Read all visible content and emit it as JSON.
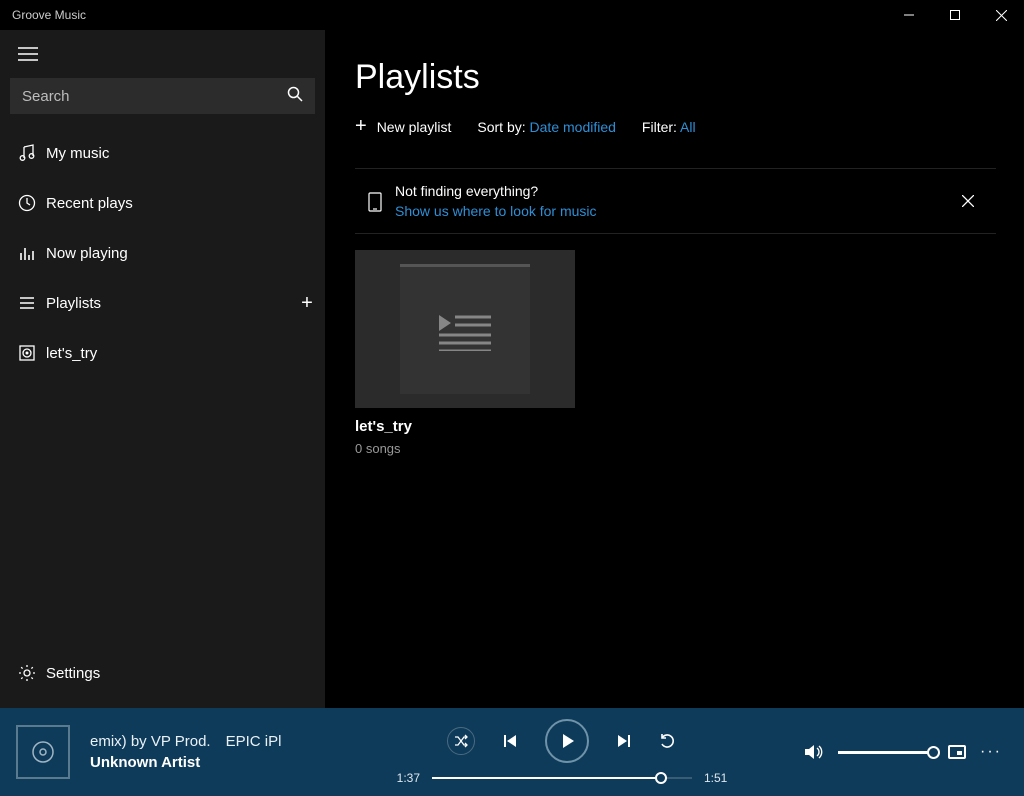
{
  "titlebar": {
    "title": "Groove Music"
  },
  "sidebar": {
    "search_placeholder": "Search",
    "items": [
      {
        "label": "My music"
      },
      {
        "label": "Recent plays"
      },
      {
        "label": "Now playing"
      },
      {
        "label": "Playlists"
      },
      {
        "label": "let's_try"
      }
    ],
    "settings_label": "Settings"
  },
  "main": {
    "heading": "Playlists",
    "new_playlist_label": "New playlist",
    "sort_label": "Sort by:",
    "sort_value": "Date modified",
    "filter_label": "Filter:",
    "filter_value": "All",
    "banner": {
      "title": "Not finding everything?",
      "link": "Show us where to look for music"
    },
    "playlists": [
      {
        "name": "let's_try",
        "songs": "0 songs"
      }
    ]
  },
  "player": {
    "track": "emix) by VP Prod. EPIC iPl",
    "artist": "Unknown Artist",
    "elapsed": "1:37",
    "duration": "1:51",
    "progress_pct": 88
  }
}
